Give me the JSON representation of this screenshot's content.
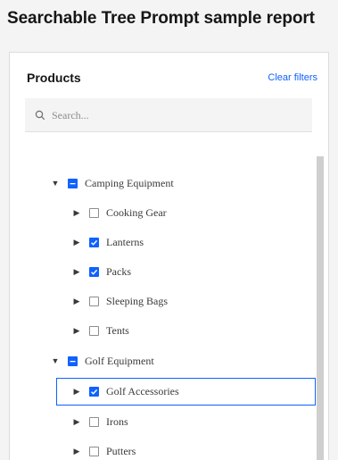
{
  "report": {
    "title": "Searchable Tree Prompt sample report"
  },
  "panel": {
    "title": "Products",
    "clear_filters": "Clear filters",
    "search": {
      "placeholder": "Search...",
      "value": ""
    }
  },
  "tree": {
    "items": [
      {
        "label": "Camping Equipment",
        "state": "indeterminate",
        "expanded": true
      },
      {
        "label": "Cooking Gear",
        "state": "unchecked",
        "expanded": false
      },
      {
        "label": "Lanterns",
        "state": "checked",
        "expanded": false
      },
      {
        "label": "Packs",
        "state": "checked",
        "expanded": false
      },
      {
        "label": "Sleeping Bags",
        "state": "unchecked",
        "expanded": false
      },
      {
        "label": "Tents",
        "state": "unchecked",
        "expanded": false
      },
      {
        "label": "Golf Equipment",
        "state": "indeterminate",
        "expanded": true
      },
      {
        "label": "Golf Accessories",
        "state": "checked",
        "expanded": false,
        "focused": true
      },
      {
        "label": "Irons",
        "state": "unchecked",
        "expanded": false
      },
      {
        "label": "Putters",
        "state": "unchecked",
        "expanded": false
      }
    ]
  },
  "icons": {
    "search": "search-icon",
    "expanded_caret": "caret-down-icon",
    "collapsed_caret": "caret-right-icon"
  },
  "colors": {
    "accent": "#0f62fe",
    "page_background": "#f4f4f4",
    "panel_background": "#ffffff"
  }
}
